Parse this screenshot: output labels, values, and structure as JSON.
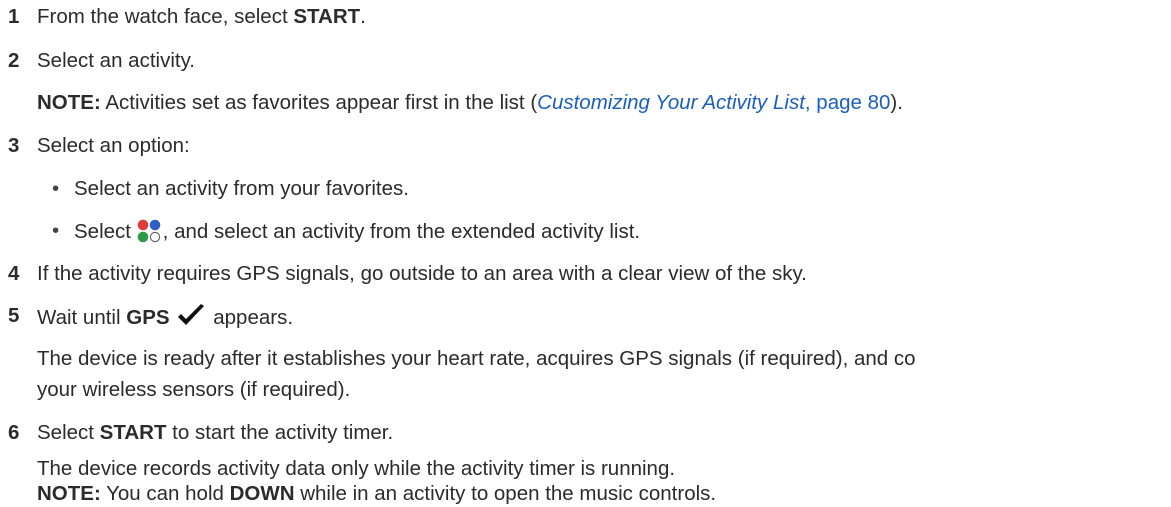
{
  "steps": {
    "s1": {
      "num": "1",
      "before": "From the watch face, select ",
      "bold": "START",
      "after": "."
    },
    "s2": {
      "num": "2",
      "text": "Select an activity.",
      "note_label": "NOTE:",
      "note_before": " Activities set as favorites appear first in the list (",
      "note_link_italic": "Customizing Your Activity List",
      "note_link_rest": ", page 80",
      "note_after": ")."
    },
    "s3": {
      "num": "3",
      "text": "Select an option:",
      "bullet_char": "•",
      "bullets": [
        {
          "text": "Select an activity from your favorites."
        },
        {
          "before": "Select ",
          "icon": "activity-list-dots-icon",
          "after": ", and select an activity from the extended activity list."
        }
      ]
    },
    "s4": {
      "num": "4",
      "text": "If the activity requires GPS signals, go outside to an area with a clear view of the sky."
    },
    "s5": {
      "num": "5",
      "before": "Wait until ",
      "bold": "GPS",
      "icon": "checkmark-icon",
      "after": " appears.",
      "para_line1": "The device is ready after it establishes your heart rate, acquires GPS signals (if required), and co",
      "para_line2": "your wireless sensors (if required)."
    },
    "s6": {
      "num": "6",
      "before": "Select ",
      "bold": "START",
      "after": " to start the activity timer.",
      "para": "The device records activity data only while the activity timer is running.",
      "note_label": "NOTE:",
      "note_before": " You can hold ",
      "note_bold": "DOWN",
      "note_after": " while in an activity to open the music controls."
    }
  },
  "colors": {
    "text": "#2b2b2b",
    "link": "#1a5fbf",
    "icon_red": "#e03a3a",
    "icon_blue": "#2f5fc8",
    "icon_green": "#2e9a48",
    "check": "#111111"
  }
}
